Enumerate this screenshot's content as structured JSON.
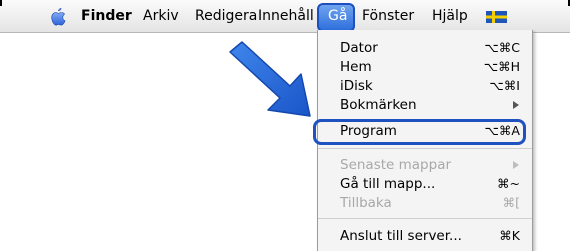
{
  "menubar": {
    "apple_icon": "apple-logo",
    "items": [
      "Finder",
      "Arkiv",
      "Redigera",
      "Innehåll",
      "Gå",
      "Fönster",
      "Hjälp"
    ],
    "active": "Gå",
    "script_icon": "swedish-flag",
    "highlight_color": "#2f6fdc"
  },
  "go_menu": {
    "items": [
      {
        "label": "Dator",
        "shortcut": "⌥⌘C"
      },
      {
        "label": "Hem",
        "shortcut": "⌥⌘H"
      },
      {
        "label": "iDisk",
        "shortcut": "⌥⌘I"
      },
      {
        "label": "Bokmärken",
        "submenu": true
      },
      {
        "label": "Program",
        "shortcut": "⌥⌘A",
        "emphasized": true
      },
      {
        "label": "Senaste mappar",
        "submenu": true,
        "disabled": true
      },
      {
        "label": "Gå till mapp...",
        "shortcut": "⌘~"
      },
      {
        "label": "Tillbaka",
        "shortcut": "⌘[",
        "disabled": true
      },
      {
        "label": "Anslut till server...",
        "shortcut": "⌘K"
      }
    ]
  },
  "annotation": {
    "arrow_icon": "blue-pointer-arrow",
    "arrow_color": "#1f63d6",
    "frame_color": "#1f52c0"
  }
}
